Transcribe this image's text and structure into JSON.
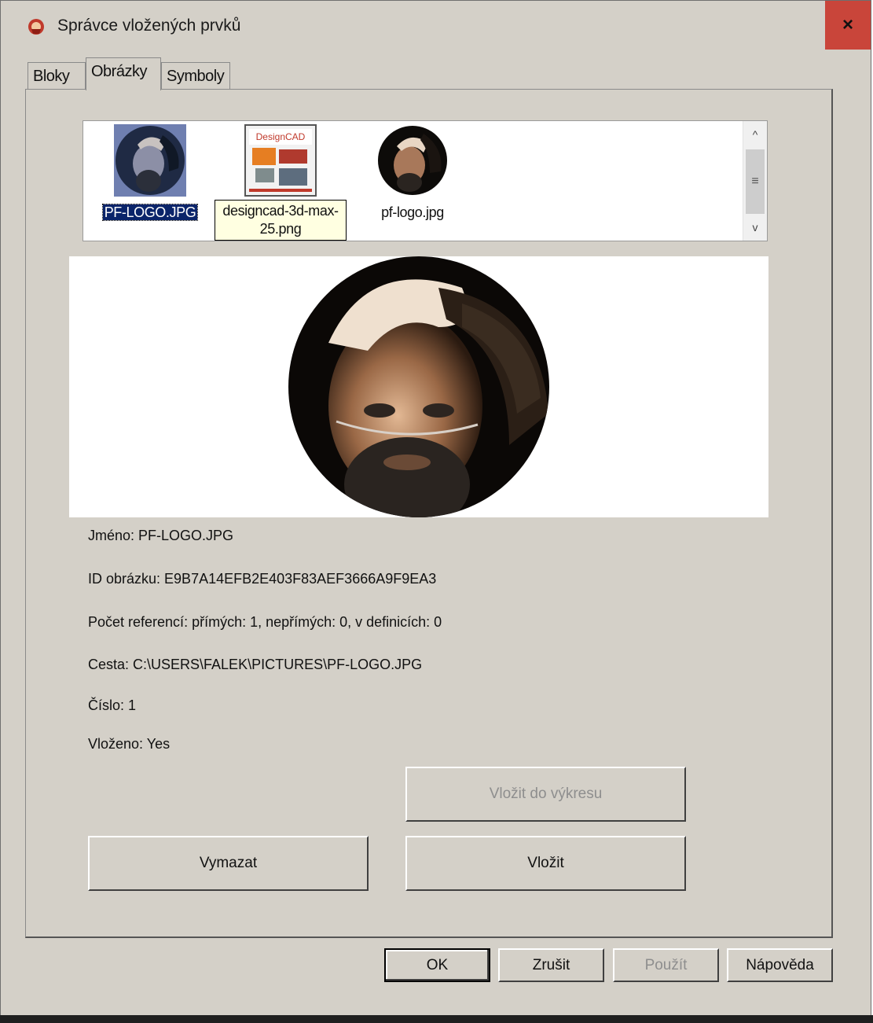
{
  "window": {
    "title": "Správce vložených prvků",
    "close_glyph": "×"
  },
  "tabs": [
    {
      "label": "Bloky",
      "active": false
    },
    {
      "label": "Obrázky",
      "active": true
    },
    {
      "label": "Symboly",
      "active": false
    }
  ],
  "thumbnails": [
    {
      "label": "PF-LOGO.JPG",
      "selected": true,
      "icon": "portrait-blue-thumbnail"
    },
    {
      "label": "designcad-3d-max-25.png",
      "selected": false,
      "icon": "designcad-box-thumbnail"
    },
    {
      "label": "pf-logo.jpg",
      "selected": false,
      "icon": "portrait-thumbnail"
    }
  ],
  "tooltip": {
    "line1": "designcad-3d-max-",
    "line2": "25.png"
  },
  "designcad_logo_text": "DesignCAD",
  "scrollbar": {
    "up": "^",
    "down": "v",
    "grip": "≡"
  },
  "info": {
    "name": "Jméno: PF-LOGO.JPG",
    "id": "ID obrázku: E9B7A14EFB2E403F83AEF3666A9F9EA3",
    "refs": "Počet referencí: přímých: 1, nepřímých: 0, v definicích: 0",
    "path": "Cesta: C:\\USERS\\FALEK\\PICTURES\\PF-LOGO.JPG",
    "number": "Číslo: 1",
    "embedded": "Vloženo: Yes"
  },
  "buttons": {
    "insert_into_drawing": "Vložit do výkresu",
    "delete": "Vymazat",
    "insert": "Vložit",
    "ok": "OK",
    "cancel": "Zrušit",
    "apply": "Použít",
    "help": "Nápověda"
  },
  "colors": {
    "dialog_bg": "#d4d0c8",
    "close_button": "#c9453a",
    "selection": "#0a246a",
    "tooltip_bg": "#ffffe1"
  }
}
